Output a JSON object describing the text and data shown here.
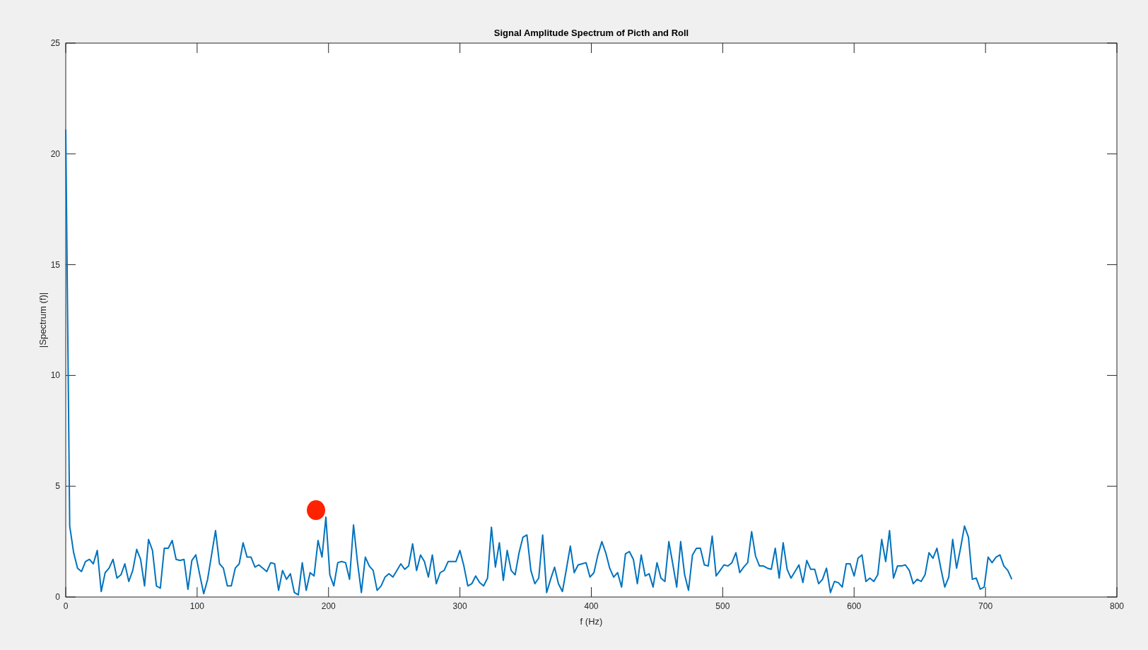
{
  "figure": {
    "chart_data": {
      "type": "line",
      "title": "Signal Amplitude Spectrum of Picth and Roll",
      "xlabel": "f (Hz)",
      "ylabel": "|Spectrum (f)|",
      "xlim": [
        0,
        800
      ],
      "ylim": [
        0,
        25
      ],
      "xticks": [
        0,
        100,
        200,
        300,
        400,
        500,
        600,
        700,
        800
      ],
      "yticks": [
        0,
        5,
        10,
        15,
        20,
        25
      ],
      "x": [
        0,
        3,
        6,
        9,
        12,
        15,
        18,
        21,
        24,
        27,
        30,
        33,
        36,
        39,
        42,
        45,
        48,
        51,
        54,
        57,
        60,
        63,
        66,
        69,
        72,
        75,
        78,
        81,
        84,
        87,
        90,
        93,
        96,
        99,
        102,
        105,
        108,
        111,
        114,
        117,
        120,
        123,
        126,
        129,
        132,
        135,
        138,
        141,
        144,
        147,
        150,
        153,
        156,
        159,
        162,
        165,
        168,
        171,
        174,
        177,
        180,
        183,
        186,
        189,
        192,
        195,
        198,
        201,
        204,
        207,
        210,
        213,
        216,
        219,
        222,
        225,
        228,
        231,
        234,
        237,
        240,
        243,
        246,
        249,
        252,
        255,
        258,
        261,
        264,
        267,
        270,
        273,
        276,
        279,
        282,
        285,
        288,
        291,
        294,
        297,
        300,
        303,
        306,
        309,
        312,
        315,
        318,
        321,
        324,
        327,
        330,
        333,
        336,
        339,
        342,
        345,
        348,
        351,
        354,
        357,
        360,
        363,
        366,
        369,
        372,
        375,
        378,
        381,
        384,
        387,
        390,
        393,
        396,
        399,
        402,
        405,
        408,
        411,
        414,
        417,
        420,
        423,
        426,
        429,
        432,
        435,
        438,
        441,
        444,
        447,
        450,
        453,
        456,
        459,
        462,
        465,
        468,
        471,
        474,
        477,
        480,
        483,
        486,
        489,
        492,
        495,
        498,
        501,
        504,
        507,
        510,
        513,
        516,
        519,
        522,
        525,
        528,
        531,
        534,
        537,
        540,
        543,
        546,
        549,
        552,
        555,
        558,
        561,
        564,
        567,
        570,
        573,
        576,
        579,
        582,
        585,
        588,
        591,
        594,
        597,
        600,
        603,
        606,
        609,
        612,
        615,
        618,
        621,
        624,
        627,
        630,
        633,
        636,
        639,
        642,
        645,
        648,
        651,
        654,
        657,
        660,
        663,
        666,
        669,
        672,
        675,
        678,
        681,
        684,
        687,
        690,
        693,
        696,
        699,
        702,
        705,
        708,
        711,
        714,
        717,
        720
      ],
      "series": [
        {
          "color": "#0072bd",
          "values": [
            21.1,
            3.2,
            2.0,
            1.3,
            1.15,
            1.6,
            1.7,
            1.5,
            2.1,
            0.25,
            1.1,
            1.3,
            1.7,
            0.85,
            1.0,
            1.5,
            0.7,
            1.2,
            2.15,
            1.7,
            0.5,
            2.6,
            2.1,
            0.5,
            0.4,
            2.2,
            2.2,
            2.55,
            1.7,
            1.65,
            1.7,
            0.35,
            1.65,
            1.9,
            1.0,
            0.15,
            0.8,
            1.9,
            3.0,
            1.5,
            1.3,
            0.5,
            0.5,
            1.3,
            1.5,
            2.45,
            1.8,
            1.8,
            1.35,
            1.45,
            1.3,
            1.15,
            1.55,
            1.5,
            0.3,
            1.2,
            0.8,
            1.05,
            0.2,
            0.1,
            1.55,
            0.3,
            1.1,
            0.95,
            2.55,
            1.8,
            3.6,
            1.0,
            0.5,
            1.55,
            1.6,
            1.55,
            0.8,
            3.25,
            1.6,
            0.2,
            1.8,
            1.4,
            1.2,
            0.3,
            0.5,
            0.9,
            1.05,
            0.9,
            1.2,
            1.5,
            1.25,
            1.4,
            2.4,
            1.2,
            1.9,
            1.6,
            0.9,
            1.9,
            0.6,
            1.1,
            1.2,
            1.6,
            1.6,
            1.6,
            2.1,
            1.4,
            0.5,
            0.6,
            0.95,
            0.65,
            0.5,
            0.85,
            3.15,
            1.35,
            2.45,
            0.75,
            2.1,
            1.2,
            1.0,
            2.0,
            2.7,
            2.8,
            1.2,
            0.6,
            0.85,
            2.8,
            0.2,
            0.8,
            1.35,
            0.6,
            0.25,
            1.25,
            2.3,
            1.1,
            1.45,
            1.5,
            1.55,
            0.9,
            1.1,
            1.9,
            2.5,
            2.0,
            1.3,
            0.9,
            1.1,
            0.45,
            1.95,
            2.05,
            1.7,
            0.6,
            1.9,
            0.95,
            1.05,
            0.45,
            1.55,
            0.85,
            0.7,
            2.5,
            1.5,
            0.45,
            2.5,
            1.0,
            0.3,
            1.9,
            2.2,
            2.2,
            1.45,
            1.4,
            2.75,
            0.95,
            1.2,
            1.45,
            1.4,
            1.55,
            2.0,
            1.1,
            1.35,
            1.55,
            2.95,
            1.85,
            1.4,
            1.4,
            1.3,
            1.25,
            2.2,
            0.85,
            2.45,
            1.25,
            0.85,
            1.15,
            1.45,
            0.65,
            1.65,
            1.25,
            1.25,
            0.6,
            0.8,
            1.3,
            0.2,
            0.7,
            0.65,
            0.45,
            1.5,
            1.5,
            0.95,
            1.75,
            1.9,
            0.7,
            0.85,
            0.7,
            1.0,
            2.6,
            1.6,
            3.0,
            0.85,
            1.4,
            1.4,
            1.45,
            1.2,
            0.6,
            0.8,
            0.7,
            1.0,
            2.0,
            1.75,
            2.2,
            1.3,
            0.45,
            0.9,
            2.6,
            1.3,
            2.2,
            3.2,
            2.7,
            0.8,
            0.85,
            0.35,
            0.45,
            1.8,
            1.55,
            1.8,
            1.9,
            1.4,
            1.2,
            0.8
          ]
        }
      ]
    }
  }
}
